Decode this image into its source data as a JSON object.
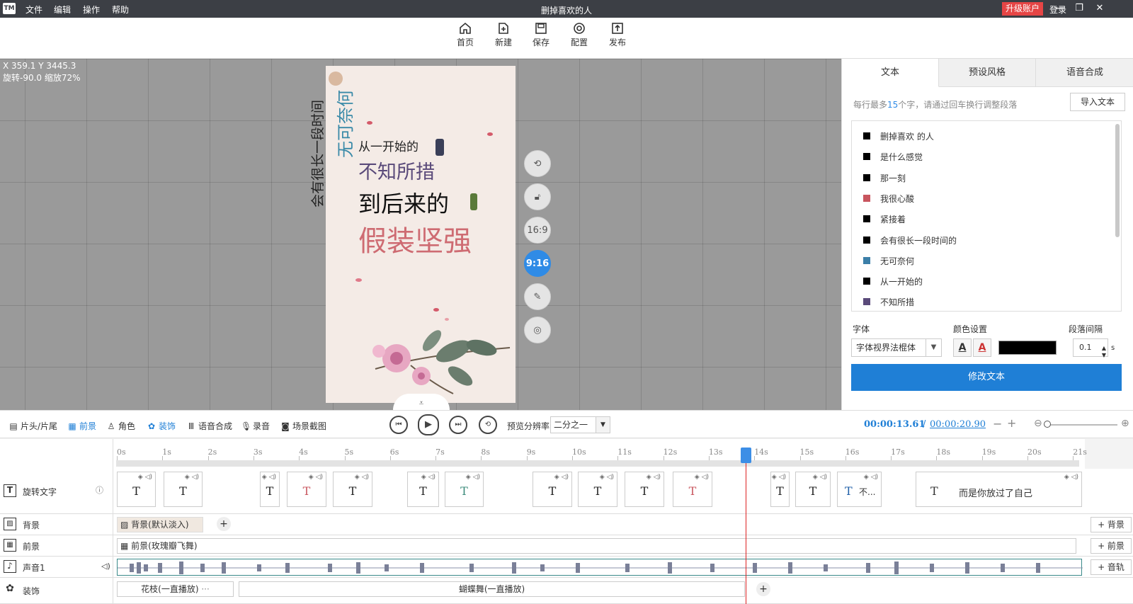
{
  "app": {
    "logo": "TM",
    "menu": [
      "文件",
      "编辑",
      "操作",
      "帮助"
    ],
    "title": "删掉喜欢的人",
    "upgrade": "升级账户",
    "login": "登录"
  },
  "toolbar": [
    {
      "label": "首页",
      "icon": "home-icon"
    },
    {
      "label": "新建",
      "icon": "new-icon"
    },
    {
      "label": "保存",
      "icon": "save-icon"
    },
    {
      "label": "配置",
      "icon": "settings-icon"
    },
    {
      "label": "发布",
      "icon": "publish-icon"
    }
  ],
  "canvas": {
    "coords": "X 359.1  Y 3445.3",
    "rotation": "旋转-90.0  缩放72%",
    "phone_texts": {
      "vertical1": "会有很长一段时间",
      "vertical2": "无可奈何",
      "line1": "从一开始的",
      "line2": "不知所措",
      "line3": "到后来的",
      "line4": "假装坚强"
    },
    "controls": [
      "16:9",
      "9:16"
    ]
  },
  "panel": {
    "tabs": [
      "文本",
      "预设风格",
      "语音合成"
    ],
    "hint_prefix": "每行最多",
    "hint_num": "15",
    "hint_suffix": "个字，请通过回车换行调整段落",
    "import_btn": "导入文本",
    "text_items": [
      {
        "text": "删掉喜欢     的人",
        "color": "#000000"
      },
      {
        "text": "是什么感觉",
        "color": "#000000"
      },
      {
        "text": "那一刻",
        "color": "#000000"
      },
      {
        "text": "    我很心酸",
        "color": "#c8555e"
      },
      {
        "text": "紧接着",
        "color": "#000000"
      },
      {
        "text": "会有很长一段时间的",
        "color": "#000000"
      },
      {
        "text": "无可奈何",
        "color": "#3c7fa8"
      },
      {
        "text": "从一开始的",
        "color": "#000000"
      },
      {
        "text": "不知所措",
        "color": "#5a4a7a"
      }
    ],
    "font_label": "字体",
    "font_value": "字体视界法棍体",
    "color_label": "颜色设置",
    "spacing_label": "段落间隔",
    "spacing_value": "0.1",
    "spacing_unit": "s",
    "modify_btn": "修改文本"
  },
  "timeline_tools": {
    "items": [
      "片头/片尾",
      "前景",
      "角色",
      "装饰",
      "语音合成",
      "录音",
      "场景截图"
    ],
    "res_label": "预览分辨率",
    "res_value": "二分之一",
    "time_current": "00:00:13.61",
    "time_sep": "/",
    "time_total": "00:00:20.90"
  },
  "ruler": [
    "0s",
    "1s",
    "2s",
    "3s",
    "4s",
    "5s",
    "6s",
    "7s",
    "8s",
    "9s",
    "10s",
    "11s",
    "12s",
    "13s",
    "14s",
    "15s",
    "16s",
    "17s",
    "18s",
    "19s",
    "20s",
    "21s"
  ],
  "tracks": {
    "text": {
      "name": "旋转文字",
      "last_clip_prefix": "不...",
      "last_clip_text": "而是你放过了自己"
    },
    "bg": {
      "name": "背景",
      "clip": "背景(默认淡入)",
      "add": "+ 背景"
    },
    "fg": {
      "name": "前景",
      "clip": "前景(玫瑰瓣飞舞)",
      "add": "+ 前景"
    },
    "audio": {
      "name": "声音1",
      "add": "+ 音轨"
    },
    "deco": {
      "name": "装饰",
      "clip1": "花枝(一直播放)",
      "clip2": "蝴蝶舞(一直播放)"
    }
  }
}
